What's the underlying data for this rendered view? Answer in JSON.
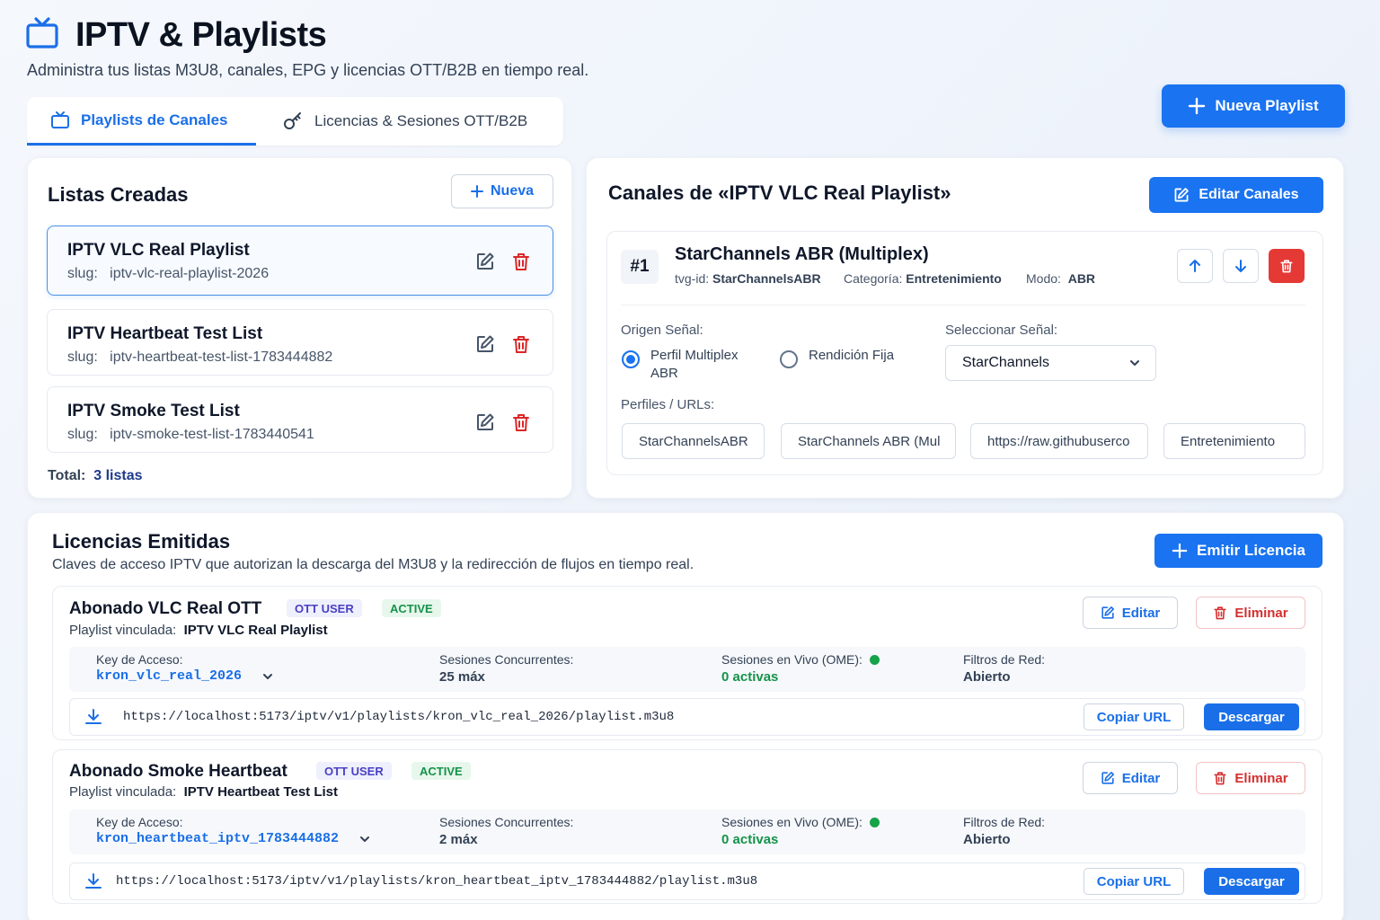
{
  "header": {
    "title": "IPTV & Playlists",
    "subtitle": "Administra tus listas M3U8, canales, EPG y licencias OTT/B2B en tiempo real.",
    "icon": "tv-icon",
    "new_playlist_label": "Nueva Playlist"
  },
  "tabs": [
    {
      "label": "Playlists de Canales",
      "icon": "tv-icon",
      "active": true
    },
    {
      "label": "Licencias & Sesiones OTT/B2B",
      "icon": "key-icon",
      "active": false
    }
  ],
  "lists_panel": {
    "title": "Listas Creadas",
    "new_label": "Nueva",
    "items": [
      {
        "name": "IPTV VLC Real Playlist",
        "slug_label": "slug:",
        "slug": "iptv-vlc-real-playlist-2026",
        "selected": true
      },
      {
        "name": "IPTV Heartbeat Test List",
        "slug_label": "slug:",
        "slug": "iptv-heartbeat-test-list-1783444882",
        "selected": false
      },
      {
        "name": "IPTV Smoke Test List",
        "slug_label": "slug:",
        "slug": "iptv-smoke-test-list-1783440541",
        "selected": false
      }
    ],
    "total_label": "Total:",
    "total_value": "3 listas"
  },
  "channels_panel": {
    "title": "Canales de «IPTV VLC Real Playlist»",
    "edit_label": "Editar Canales",
    "channel": {
      "number": "#1",
      "name": "StarChannels ABR (Multiplex)",
      "tvg_id_label": "tvg-id:",
      "tvg_id": "StarChannelsABR",
      "category_label": "Categoría:",
      "category": "Entretenimiento",
      "mode_label": "Modo:",
      "mode": "ABR",
      "origin_label": "Origen Señal:",
      "origin_options": [
        {
          "line1": "Perfil Multiplex",
          "line2": "ABR",
          "checked": true
        },
        {
          "line1": "Rendición Fija",
          "line2": "",
          "checked": false
        }
      ],
      "select_label": "Seleccionar Señal:",
      "select_value": "StarChannels",
      "profiles_label": "Perfiles / URLs:",
      "profile_fields": [
        "StarChannelsABR",
        "StarChannels ABR (Mul",
        "https://raw.githubuserco",
        "Entretenimiento"
      ]
    }
  },
  "licenses": {
    "title": "Licencias Emitidas",
    "subtitle": "Claves de acceso IPTV que autorizan la descarga del M3U8 y la redirección de flujos en tiempo real.",
    "emit_label": "Emitir Licencia",
    "items": [
      {
        "name": "Abonado VLC Real OTT",
        "badge_type": "OTT USER",
        "badge_status": "ACTIVE",
        "playlist_label": "Playlist vinculada:",
        "playlist": "IPTV VLC Real Playlist",
        "key_label": "Key de Acceso:",
        "key": "kron_vlc_real_2026",
        "sessions_label": "Sesiones Concurrentes:",
        "sessions": "25 máx",
        "live_label": "Sesiones en Vivo (OME):",
        "live": "0 activas",
        "filters_label": "Filtros de Red:",
        "filters": "Abierto",
        "url": "https://localhost:5173/iptv/v1/playlists/kron_vlc_real_2026/playlist.m3u8",
        "edit_label": "Editar",
        "delete_label": "Eliminar",
        "copy_label": "Copiar URL",
        "download_label": "Descargar"
      },
      {
        "name": "Abonado Smoke Heartbeat",
        "badge_type": "OTT USER",
        "badge_status": "ACTIVE",
        "playlist_label": "Playlist vinculada:",
        "playlist": "IPTV Heartbeat Test List",
        "key_label": "Key de Acceso:",
        "key": "kron_heartbeat_iptv_1783444882",
        "sessions_label": "Sesiones Concurrentes:",
        "sessions": "2 máx",
        "live_label": "Sesiones en Vivo (OME):",
        "live": "0 activas",
        "filters_label": "Filtros de Red:",
        "filters": "Abierto",
        "url": "https://localhost:5173/iptv/v1/playlists/kron_heartbeat_iptv_1783444882/playlist.m3u8",
        "edit_label": "Editar",
        "delete_label": "Eliminar",
        "copy_label": "Copiar URL",
        "download_label": "Descargar"
      }
    ]
  },
  "colors": {
    "primary": "#1a73f0",
    "danger": "#e53935",
    "success": "#16924a",
    "badge_ott": "#4b3fc4"
  }
}
